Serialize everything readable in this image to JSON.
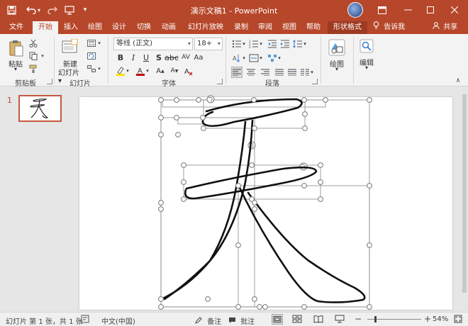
{
  "titlebar": {
    "title": "演示文稿1 - PowerPoint",
    "quick_access": [
      {
        "name": "save-icon",
        "glyph": "💾"
      },
      {
        "name": "undo-icon",
        "glyph": "↶"
      },
      {
        "name": "redo-icon",
        "glyph": "↷"
      },
      {
        "name": "start-from-beginning-icon",
        "glyph": "🖵"
      },
      {
        "name": "customize-qat-icon",
        "glyph": "▾"
      }
    ],
    "window_buttons": [
      {
        "name": "ribbon-display-options-icon",
        "glyph": "▣"
      },
      {
        "name": "minimize-icon",
        "glyph": "─"
      },
      {
        "name": "maximize-icon",
        "glyph": "☐"
      },
      {
        "name": "close-icon",
        "glyph": "✕"
      }
    ]
  },
  "tabs": {
    "items": [
      "文件",
      "开始",
      "插入",
      "绘图",
      "设计",
      "切换",
      "动画",
      "幻灯片放映",
      "录制",
      "审阅",
      "视图",
      "帮助",
      "形状格式"
    ],
    "active": "开始",
    "contextual": "形状格式",
    "tell_me": "告诉我",
    "share": "共享"
  },
  "ribbon": {
    "clipboard": {
      "label": "剪贴板",
      "paste": "粘贴"
    },
    "slides": {
      "label": "幻灯片",
      "new_slide": "新建",
      "new_slide_2": "幻灯片"
    },
    "font": {
      "label": "字体",
      "font_name": "等线 (正文)",
      "font_size": "18+",
      "red": "#c00000",
      "yellow": "#ffde00"
    },
    "paragraph": {
      "label": "段落"
    },
    "drawing": {
      "label": "绘图"
    },
    "editing": {
      "label": "编辑"
    }
  },
  "thumbnails": {
    "slide_number": "1"
  },
  "statusbar": {
    "slide_info": "幻灯片 第 1 张，共 1 张",
    "language": "中文(中国)",
    "notes": "备注",
    "comments": "批注",
    "zoom": "54%"
  },
  "colors": {
    "accent": "#b7472a",
    "ribbon_bg": "#f3f3f3"
  }
}
